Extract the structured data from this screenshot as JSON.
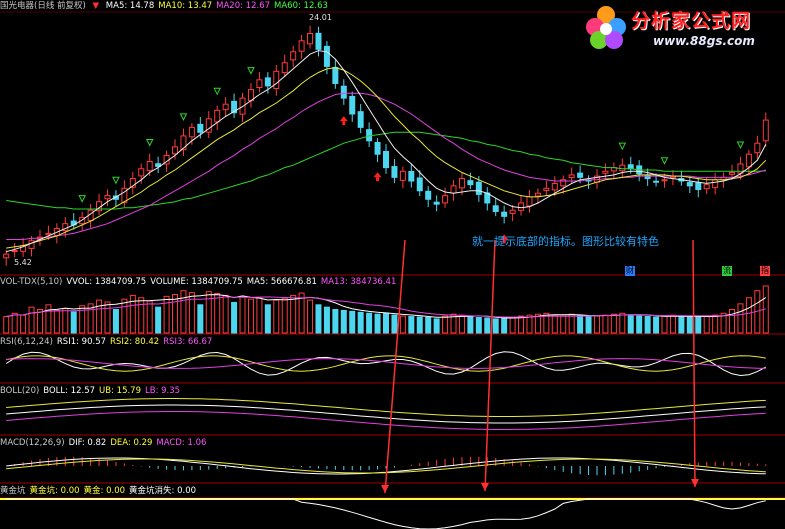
{
  "window": {
    "title_prefix": "国光电器(日线 前复权)"
  },
  "logo": {
    "name": "分析家公式网",
    "url": "www.88gs.com"
  },
  "annotation": "就一提示底部的指标。图形比较有特色",
  "badges": [
    {
      "text": "财",
      "color": "#2a7cff"
    },
    {
      "text": "流",
      "color": "#2ecc40"
    },
    {
      "text": "指",
      "color": "#ff4040"
    }
  ],
  "chart_data": [
    {
      "type": "candlestick",
      "panel": "main",
      "legend": [
        {
          "text": "MA5: 14.78",
          "color": "#ffffff"
        },
        {
          "text": "MA10: 13.47",
          "color": "#ffff3a"
        },
        {
          "text": "MA20: 12.67",
          "color": "#ff55ff"
        },
        {
          "text": "MA60: 12.63",
          "color": "#44ff44"
        }
      ],
      "high_label": "24.01",
      "low_label": "5.42",
      "ylim": [
        4.5,
        25.5
      ],
      "closes": [
        5.8,
        6.1,
        6.5,
        6.9,
        7.2,
        7.5,
        7.9,
        8.3,
        8.2,
        8.8,
        9.4,
        10.1,
        10.6,
        10.3,
        11.2,
        12.0,
        12.8,
        13.4,
        13.0,
        13.9,
        14.6,
        15.5,
        16.2,
        15.8,
        16.9,
        17.6,
        18.1,
        17.4,
        18.6,
        19.3,
        20.1,
        19.6,
        20.8,
        21.5,
        22.4,
        23.3,
        23.9,
        22.6,
        21.2,
        19.8,
        18.6,
        17.3,
        16.2,
        15.1,
        14.0,
        12.9,
        12.1,
        12.6,
        11.8,
        11.0,
        10.3,
        9.9,
        10.6,
        11.4,
        12.0,
        11.5,
        10.7,
        10.0,
        9.3,
        8.9,
        9.4,
        10.0,
        10.5,
        10.8,
        11.2,
        11.6,
        11.9,
        12.3,
        12.1,
        11.8,
        12.2,
        12.6,
        12.9,
        13.1,
        12.8,
        12.4,
        12.0,
        11.7,
        11.9,
        12.2,
        11.8,
        11.4,
        11.1,
        11.5,
        11.9,
        12.1,
        12.5,
        13.2,
        14.0,
        14.9,
        16.8
      ],
      "ma5": [
        6.0,
        6.2,
        6.4,
        6.7,
        7.0,
        7.3,
        7.6,
        7.9,
        8.2,
        8.6,
        9.1,
        9.6,
        10.1,
        10.5,
        10.9,
        11.4,
        11.9,
        12.5,
        12.9,
        13.4,
        13.9,
        14.5,
        15.1,
        15.6,
        16.1,
        16.6,
        17.1,
        17.5,
        17.9,
        18.4,
        18.9,
        19.3,
        19.8,
        20.4,
        21.0,
        21.6,
        22.2,
        22.5,
        22.4,
        21.8,
        20.9,
        19.9,
        18.8,
        17.7,
        16.6,
        15.5,
        14.5,
        13.8,
        13.2,
        12.5,
        11.8,
        11.2,
        10.9,
        10.8,
        10.9,
        11.0,
        11.0,
        10.8,
        10.4,
        10.0,
        9.7,
        9.6,
        9.7,
        10.0,
        10.4,
        10.8,
        11.2,
        11.6,
        11.9,
        12.0,
        12.1,
        12.2,
        12.3,
        12.5,
        12.6,
        12.6,
        12.5,
        12.3,
        12.1,
        12.0,
        11.9,
        11.8,
        11.7,
        11.6,
        11.7,
        11.8,
        12.0,
        12.4,
        12.9,
        13.5,
        14.8
      ],
      "ma10": [
        6.3,
        6.4,
        6.5,
        6.7,
        6.9,
        7.1,
        7.3,
        7.6,
        7.9,
        8.2,
        8.5,
        8.9,
        9.3,
        9.7,
        10.1,
        10.5,
        10.9,
        11.4,
        11.8,
        12.3,
        12.7,
        13.2,
        13.7,
        14.2,
        14.7,
        15.2,
        15.6,
        16.0,
        16.5,
        16.9,
        17.4,
        17.8,
        18.2,
        18.7,
        19.2,
        19.8,
        20.3,
        20.7,
        21.0,
        21.1,
        20.9,
        20.5,
        20.0,
        19.4,
        18.7,
        17.9,
        17.1,
        16.4,
        15.7,
        15.1,
        14.4,
        13.8,
        13.3,
        12.9,
        12.5,
        12.2,
        11.9,
        11.6,
        11.3,
        11.0,
        10.8,
        10.6,
        10.5,
        10.5,
        10.6,
        10.7,
        10.9,
        11.1,
        11.3,
        11.5,
        11.7,
        11.9,
        12.0,
        12.1,
        12.2,
        12.3,
        12.3,
        12.3,
        12.3,
        12.2,
        12.2,
        12.1,
        12.0,
        11.9,
        11.9,
        11.9,
        12.0,
        12.1,
        12.4,
        12.8,
        13.5
      ],
      "ma20": [
        7.0,
        7.0,
        7.0,
        7.1,
        7.1,
        7.2,
        7.3,
        7.4,
        7.5,
        7.7,
        7.9,
        8.1,
        8.3,
        8.6,
        8.9,
        9.2,
        9.5,
        9.8,
        10.2,
        10.6,
        11.0,
        11.4,
        11.8,
        12.2,
        12.6,
        13.1,
        13.5,
        13.9,
        14.4,
        14.8,
        15.3,
        15.7,
        16.1,
        16.6,
        17.0,
        17.5,
        17.9,
        18.3,
        18.6,
        18.9,
        19.0,
        19.0,
        19.0,
        18.9,
        18.7,
        18.4,
        18.1,
        17.7,
        17.3,
        16.8,
        16.3,
        15.8,
        15.3,
        14.9,
        14.4,
        14.0,
        13.6,
        13.3,
        13.0,
        12.7,
        12.5,
        12.3,
        12.1,
        12.0,
        11.9,
        11.8,
        11.8,
        11.8,
        11.8,
        11.9,
        11.9,
        12.0,
        12.0,
        12.1,
        12.1,
        12.2,
        12.2,
        12.2,
        12.2,
        12.2,
        12.2,
        12.2,
        12.1,
        12.1,
        12.1,
        12.1,
        12.1,
        12.2,
        12.3,
        12.5,
        12.7
      ],
      "ma60": [
        10.2,
        10.1,
        10.0,
        9.9,
        9.8,
        9.7,
        9.6,
        9.6,
        9.5,
        9.5,
        9.5,
        9.5,
        9.5,
        9.5,
        9.6,
        9.6,
        9.7,
        9.8,
        9.9,
        10.0,
        10.1,
        10.3,
        10.4,
        10.6,
        10.8,
        11.0,
        11.2,
        11.4,
        11.6,
        11.8,
        12.1,
        12.3,
        12.6,
        12.9,
        13.1,
        13.4,
        13.7,
        14.0,
        14.3,
        14.6,
        14.9,
        15.1,
        15.3,
        15.5,
        15.6,
        15.7,
        15.8,
        15.8,
        15.8,
        15.8,
        15.7,
        15.6,
        15.5,
        15.4,
        15.3,
        15.1,
        15.0,
        14.8,
        14.7,
        14.5,
        14.3,
        14.2,
        14.0,
        13.9,
        13.7,
        13.6,
        13.5,
        13.3,
        13.2,
        13.1,
        13.0,
        12.9,
        12.9,
        12.8,
        12.8,
        12.7,
        12.7,
        12.7,
        12.6,
        12.6,
        12.6,
        12.6,
        12.6,
        12.6,
        12.6,
        12.6,
        12.6,
        12.6,
        12.6,
        12.6,
        12.63
      ]
    },
    {
      "type": "bar",
      "panel": "volume",
      "legend": [
        {
          "text": "VOL-TDX(5,10)",
          "color": "#c8c8c8"
        },
        {
          "text": "VVOL: 1384709.75",
          "color": "#ffffff"
        },
        {
          "text": "VOLUME: 1384709.75",
          "color": "#ffffff"
        },
        {
          "text": "MA5: 566676.81",
          "color": "#ffffff"
        },
        {
          "text": "MA13: 384736.41",
          "color": "#ff55ff"
        }
      ],
      "values": [
        0.35,
        0.42,
        0.38,
        0.55,
        0.5,
        0.6,
        0.48,
        0.52,
        0.45,
        0.58,
        0.62,
        0.7,
        0.66,
        0.5,
        0.72,
        0.8,
        0.75,
        0.68,
        0.55,
        0.78,
        0.82,
        0.9,
        0.86,
        0.6,
        0.88,
        0.84,
        0.8,
        0.65,
        0.78,
        0.72,
        0.76,
        0.6,
        0.7,
        0.74,
        0.8,
        0.85,
        0.7,
        0.6,
        0.55,
        0.5,
        0.48,
        0.46,
        0.44,
        0.42,
        0.4,
        0.42,
        0.38,
        0.36,
        0.35,
        0.34,
        0.33,
        0.3,
        0.36,
        0.4,
        0.38,
        0.35,
        0.33,
        0.32,
        0.3,
        0.31,
        0.34,
        0.36,
        0.38,
        0.4,
        0.42,
        0.38,
        0.36,
        0.4,
        0.37,
        0.35,
        0.36,
        0.38,
        0.4,
        0.42,
        0.38,
        0.36,
        0.35,
        0.34,
        0.36,
        0.38,
        0.35,
        0.33,
        0.34,
        0.36,
        0.38,
        0.42,
        0.5,
        0.62,
        0.75,
        0.9,
        1.0
      ]
    },
    {
      "type": "line",
      "panel": "rsi",
      "legend": [
        {
          "text": "RSI(6,12,24)",
          "color": "#c8c8c8"
        },
        {
          "text": "RSI1: 90.57",
          "color": "#ffffff"
        },
        {
          "text": "RSI2: 80.42",
          "color": "#ffff3a"
        },
        {
          "text": "RSI3: 66.67",
          "color": "#ff55ff"
        }
      ]
    },
    {
      "type": "line",
      "panel": "boll",
      "legend": [
        {
          "text": "BOLL(20)",
          "color": "#c8c8c8"
        },
        {
          "text": "BOLL: 12.57",
          "color": "#ffffff"
        },
        {
          "text": "UB: 15.79",
          "color": "#ffff3a"
        },
        {
          "text": "LB: 9.35",
          "color": "#ff55ff"
        }
      ]
    },
    {
      "type": "line",
      "panel": "macd",
      "legend": [
        {
          "text": "MACD(12,26,9)",
          "color": "#c8c8c8"
        },
        {
          "text": "DIF: 0.82",
          "color": "#ffffff"
        },
        {
          "text": "DEA: 0.29",
          "color": "#ffff3a"
        },
        {
          "text": "MACD: 1.06",
          "color": "#ff55ff"
        }
      ]
    },
    {
      "type": "line",
      "panel": "pit",
      "legend": [
        {
          "text": "黄金坑",
          "color": "#c8c8c8"
        },
        {
          "text": "黄金坑: 0.00",
          "color": "#ffff3a"
        },
        {
          "text": "黄金: 0.00",
          "color": "#ffff3a"
        },
        {
          "text": "黄金坑消失: 0.00",
          "color": "#ffffff"
        }
      ]
    }
  ]
}
